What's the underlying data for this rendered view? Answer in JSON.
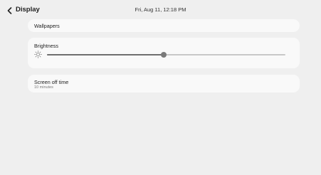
{
  "header": {
    "back_icon": "chevron-left-icon",
    "title": "Display",
    "datetime": "Fri, Aug 11, 12:18 PM"
  },
  "wallpapers": {
    "label": "Wallpapers"
  },
  "brightness": {
    "label": "Brightness",
    "icon": "sun-icon",
    "level_percent": 49
  },
  "screen_off": {
    "label": "Screen off time",
    "value": "10 minutes"
  },
  "colors": {
    "background": "#efefef",
    "card": "#f9f9f9",
    "slider_fill": "#6f6f6f",
    "slider_track": "#c8c8c8"
  }
}
